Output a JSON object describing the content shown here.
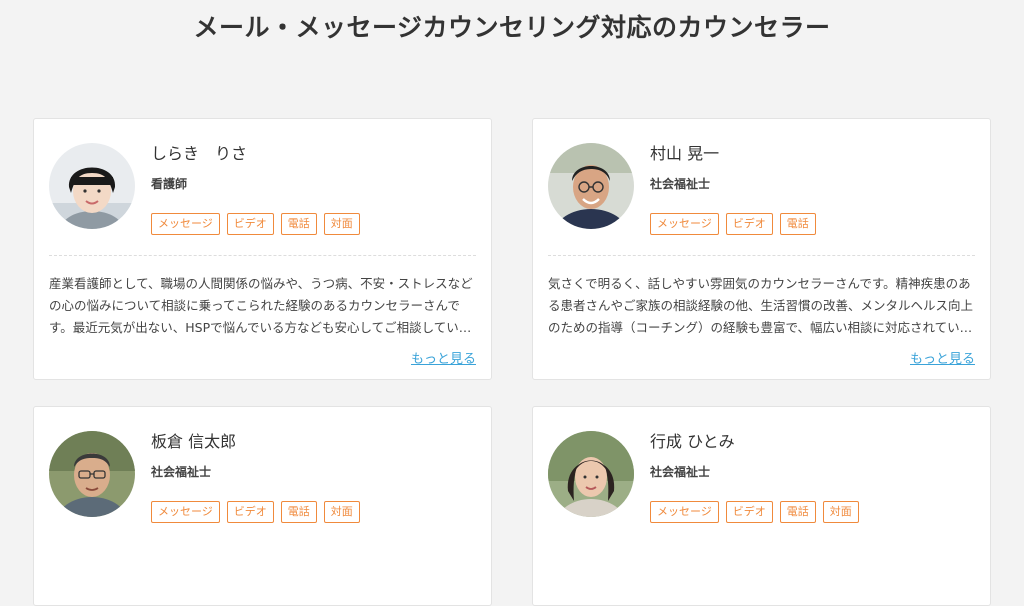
{
  "page": {
    "title": "メール・メッセージカウンセリング対応のカウンセラー"
  },
  "colors": {
    "accent_tag": "#f08a3c",
    "link": "#3aa3d9",
    "background": "#f3f3f3"
  },
  "counselors": [
    {
      "name": "しらき　りさ",
      "role": "看護師",
      "tags": [
        "メッセージ",
        "ビデオ",
        "電話",
        "対面"
      ],
      "description": "産業看護師として、職場の人間関係の悩みや、うつ病、不安・ストレスなどの心の悩みについて相談に乗ってこられた経験のあるカウンセラーさんです。最近元気が出ない、HSPで悩んでいる方なども安心してご相談してい…",
      "more": "もっと見る"
    },
    {
      "name": "村山 晃一",
      "role": "社会福祉士",
      "tags": [
        "メッセージ",
        "ビデオ",
        "電話"
      ],
      "description": "気さくで明るく、話しやすい雰囲気のカウンセラーさんです。精神疾患のある患者さんやご家族の相談経験の他、生活習慣の改善、メンタルヘルス向上のための指導（コーチング）の経験も豊富で、幅広い相談に対応されてい…",
      "more": "もっと見る"
    },
    {
      "name": "板倉 信太郎",
      "role": "社会福祉士",
      "tags": [
        "メッセージ",
        "ビデオ",
        "電話",
        "対面"
      ]
    },
    {
      "name": "行成 ひとみ",
      "role": "社会福祉士",
      "tags": [
        "メッセージ",
        "ビデオ",
        "電話",
        "対面"
      ]
    }
  ]
}
